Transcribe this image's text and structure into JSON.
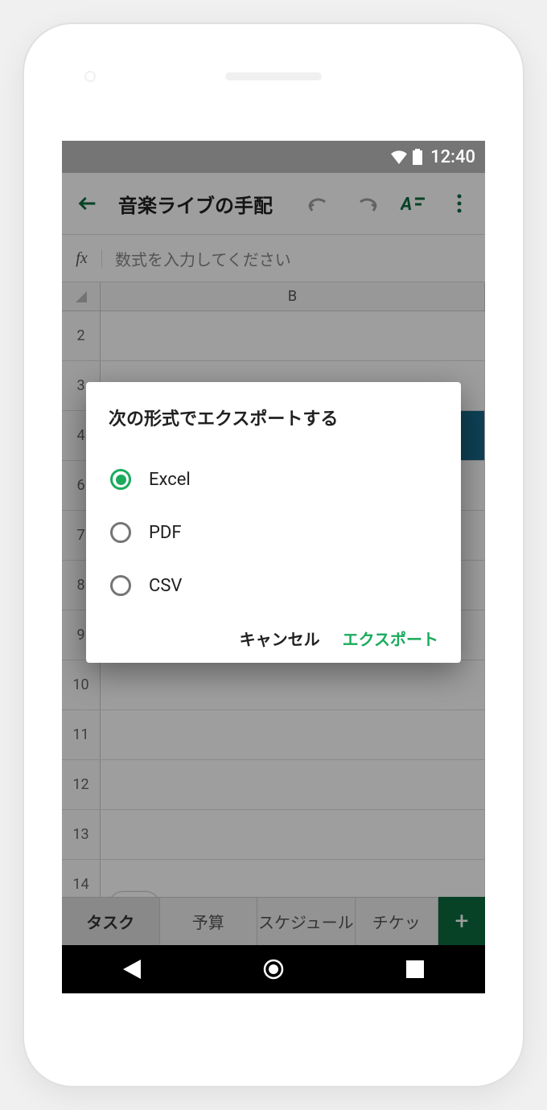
{
  "status": {
    "time": "12:40"
  },
  "appbar": {
    "title": "音楽ライブの手配"
  },
  "formula": {
    "fx": "fx",
    "placeholder": "数式を入力してください"
  },
  "sheet": {
    "col_header": "B",
    "rows": [
      "2",
      "3",
      "4",
      "6",
      "7",
      "8",
      "9",
      "10",
      "11",
      "12",
      "13",
      "14"
    ]
  },
  "tabs": {
    "items": [
      "タスク",
      "予算",
      "スケジュール",
      "チケッ"
    ]
  },
  "dialog": {
    "title": "次の形式でエクスポートする",
    "options": {
      "0": "Excel",
      "1": "PDF",
      "2": "CSV"
    },
    "cancel": "キャンセル",
    "confirm": "エクスポート"
  }
}
